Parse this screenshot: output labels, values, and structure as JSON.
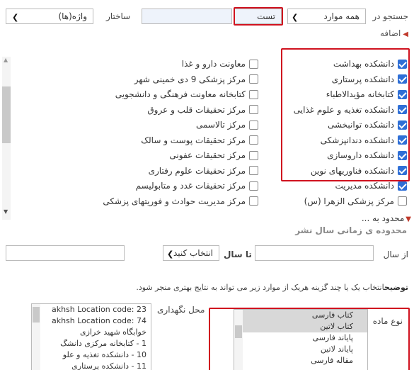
{
  "search": {
    "search_in_label": "جستجو در",
    "scope_select": "همه موارد",
    "query_value": "تست",
    "structure_label": "ساختار",
    "structure_input": "",
    "word_select": "واژه(ها)"
  },
  "add_label": "اضافه",
  "right_items": [
    {
      "label": "دانشکده بهداشت",
      "checked": true
    },
    {
      "label": "دانشکده پرستاری",
      "checked": true
    },
    {
      "label": "کتابخانه مؤیدالاطباء",
      "checked": true
    },
    {
      "label": "دانشکده تغذیه و علوم غذایی",
      "checked": true
    },
    {
      "label": "دانشکده توانبخشی",
      "checked": true
    },
    {
      "label": "دانشکده دندانپزشکی",
      "checked": true
    },
    {
      "label": "دانشکده داروسازی",
      "checked": true
    },
    {
      "label": "دانشکده فناوریهای نوین",
      "checked": true
    },
    {
      "label": "دانشکده مدیریت",
      "checked": true
    },
    {
      "label": "مرکز پزشکی الزهرا (س)",
      "checked": false
    }
  ],
  "left_items": [
    {
      "label": "معاونت دارو و غذا",
      "checked": false
    },
    {
      "label": "مرکز پزشکی 9 دی خمینی شهر",
      "checked": false
    },
    {
      "label": "کتابخانه معاونت فرهنگی و دانشجویی",
      "checked": false
    },
    {
      "label": "مرکز تحقیقات قلب و عروق",
      "checked": false
    },
    {
      "label": "مرکز تالاسمی",
      "checked": false
    },
    {
      "label": "مرکز تحقیقات پوست و سالک",
      "checked": false
    },
    {
      "label": "مرکز تحقیقات عفونی",
      "checked": false
    },
    {
      "label": "مرکز تحقیقات علوم رفتاری",
      "checked": false
    },
    {
      "label": "مرکز تحقیقات غدد و متابولیسم",
      "checked": false
    },
    {
      "label": "مرکز مدیریت حوادث و فوریتهای پزشکی",
      "checked": false
    }
  ],
  "limit_label": "محدود به ...",
  "publish_range_label": "محدوده ی زمانی سال نشر",
  "year": {
    "from_label": "از سال",
    "from_value": "",
    "to_label": "تا سال",
    "to_select": "انتخاب کنید",
    "to_value": ""
  },
  "hint": {
    "title": "توضیح",
    "text": "انتخاب یک یا چند گزینه هریک از موارد زیر می تواند به نتایج بهتری منجر شود."
  },
  "material": {
    "label": "نوع ماده",
    "options": [
      {
        "label": "کتاب فارسی",
        "selected": true
      },
      {
        "label": "کتاب لاتین",
        "selected": true
      },
      {
        "label": "پایاند فارسی",
        "selected": false
      },
      {
        "label": "پایاند لاتین",
        "selected": false
      },
      {
        "label": "مقاله فارسی",
        "selected": false
      }
    ]
  },
  "location": {
    "label": "محل نگهداری",
    "options": [
      "akhsh Location code: 23",
      "akhsh Location code: 74",
      "خوابگاه شهید خرازی",
      "1 - کتابخانه مرکزی دانشگ",
      "10 - دانشکده تغذیه و علو",
      "11 - دانشکده پرستاری"
    ]
  },
  "colors": {
    "highlight": "#d0121f",
    "checkbox": "#2f6fd6",
    "accent_arrow": "#c0392b"
  },
  "icons": {
    "dropdown": "chevron-down-icon",
    "expand": "triangle-left-icon"
  }
}
